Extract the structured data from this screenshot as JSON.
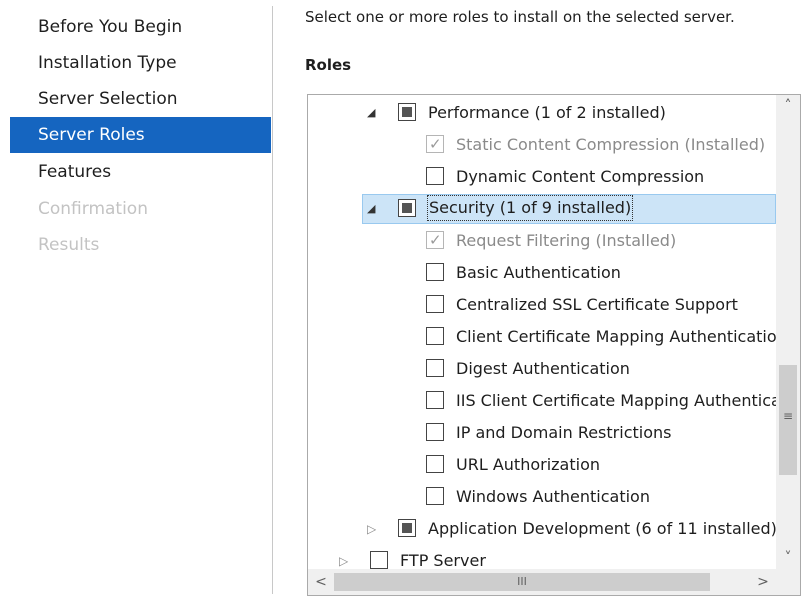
{
  "nav": {
    "items": [
      {
        "label": "Before You Begin",
        "state": "normal"
      },
      {
        "label": "Installation Type",
        "state": "normal"
      },
      {
        "label": "Server Selection",
        "state": "normal"
      },
      {
        "label": "Server Roles",
        "state": "selected"
      },
      {
        "label": "Features",
        "state": "normal"
      },
      {
        "label": "Confirmation",
        "state": "disabled"
      },
      {
        "label": "Results",
        "state": "disabled"
      }
    ]
  },
  "main": {
    "instruction": "Select one or more roles to install on the selected server.",
    "roles_label": "Roles"
  },
  "tree": {
    "rows": [
      {
        "label": "Performance (1 of 2 installed)",
        "expander": "expanded",
        "check": "partial"
      },
      {
        "label": "Static Content Compression (Installed)",
        "check": "checked-disabled"
      },
      {
        "label": "Dynamic Content Compression",
        "check": "unchecked"
      },
      {
        "label": "Security (1 of 9 installed)",
        "expander": "expanded",
        "check": "partial",
        "selected": true
      },
      {
        "label": "Request Filtering (Installed)",
        "check": "checked-disabled"
      },
      {
        "label": "Basic Authentication",
        "check": "unchecked"
      },
      {
        "label": "Centralized SSL Certificate Support",
        "check": "unchecked"
      },
      {
        "label": "Client Certificate Mapping Authenticatio",
        "check": "unchecked"
      },
      {
        "label": "Digest Authentication",
        "check": "unchecked"
      },
      {
        "label": "IIS Client Certificate Mapping Authentica",
        "check": "unchecked"
      },
      {
        "label": "IP and Domain Restrictions",
        "check": "unchecked"
      },
      {
        "label": "URL Authorization",
        "check": "unchecked"
      },
      {
        "label": "Windows Authentication",
        "check": "unchecked"
      },
      {
        "label": "Application Development (6 of 11 installed)",
        "expander": "collapsed",
        "check": "partial"
      },
      {
        "label": "FTP Server",
        "expander": "collapsed",
        "check": "unchecked"
      }
    ]
  },
  "scrollbar": {
    "up_glyph": "˄",
    "down_glyph": "˅",
    "left_glyph": "<",
    "right_glyph": ">",
    "vertical_grip": "≡",
    "horizontal_grip": "III"
  },
  "colors": {
    "nav_selected": "#1565c0",
    "tree_selection": "#cce4f7",
    "disabled_text": "#c3c3c3"
  },
  "icons": {
    "expanded": "expand-triangle-icon",
    "collapsed": "collapse-triangle-icon"
  }
}
